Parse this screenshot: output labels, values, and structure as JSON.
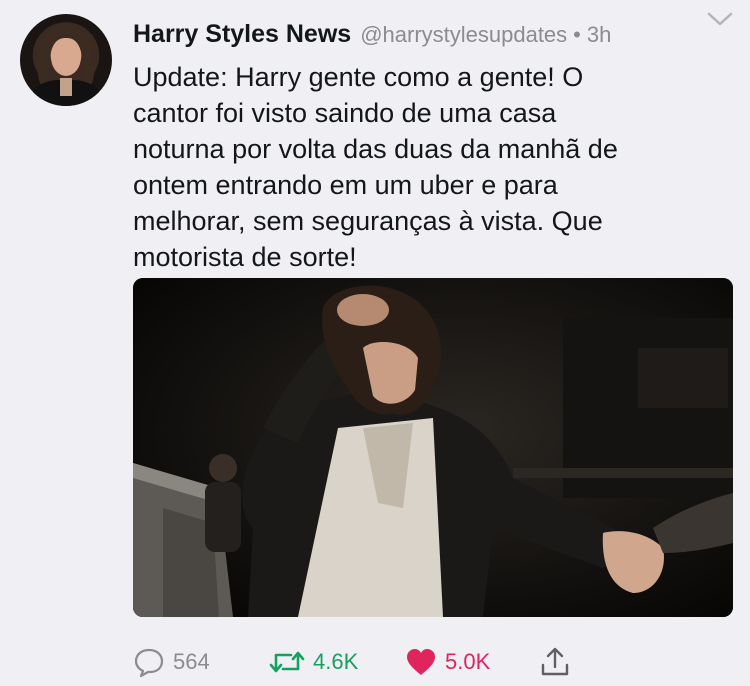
{
  "tweet": {
    "author_name": "Harry Styles News",
    "handle": "@harrystylesupdates",
    "separator": "•",
    "time": "3h",
    "text": "Update: Harry gente como a gente! O\ncantor foi visto saindo de uma casa\nnoturna por volta das duas da manhã de\nontem entrando em um uber e para\nmelhorar, sem seguranças à vista. Que\nmotorista de sorte!"
  },
  "actions": {
    "reply_count": "564",
    "retweet_count": "4.6K",
    "like_count": "5.0K"
  },
  "icons": {
    "reply": "reply-icon",
    "retweet": "retweet-icon",
    "like": "heart-icon",
    "share": "share-icon",
    "menu": "chevron-down-icon"
  },
  "colors": {
    "background": "#efeff4",
    "secondary_text": "#8b8b90",
    "retweet": "#19a061",
    "like": "#e0245e"
  }
}
